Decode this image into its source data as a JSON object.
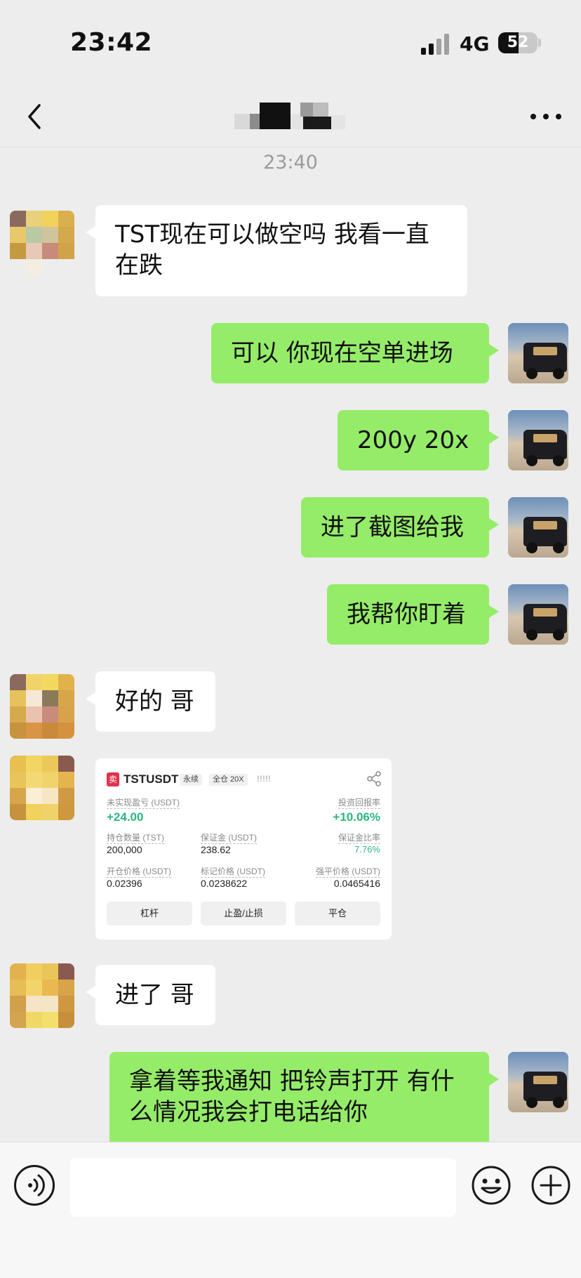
{
  "status_bar": {
    "time": "23:42",
    "network": "4G",
    "battery": "52",
    "icons": [
      "signal-icon",
      "battery-icon"
    ]
  },
  "nav": {
    "back_icon": "chevron-left-icon",
    "more_icon": "ellipsis-icon",
    "title_blurred": true
  },
  "chat": {
    "timestamp": "23:40",
    "messages": [
      {
        "side": "in",
        "lines": [
          "TST现在可以做空吗 我看一直",
          "在跌"
        ]
      },
      {
        "side": "out",
        "lines": [
          "可以 你现在空单进场"
        ]
      },
      {
        "side": "out",
        "lines": [
          "200y 20x"
        ]
      },
      {
        "side": "out",
        "lines": [
          "进了截图给我"
        ]
      },
      {
        "side": "out",
        "lines": [
          "我帮你盯着"
        ]
      },
      {
        "side": "in",
        "lines": [
          "好的 哥"
        ]
      },
      {
        "side": "in",
        "type": "image-card"
      },
      {
        "side": "in",
        "lines": [
          "进了 哥"
        ]
      },
      {
        "side": "out",
        "lines": [
          "拿着等我通知 把铃声打开 有什",
          "么情况我会打电话给你"
        ]
      }
    ]
  },
  "trade_card": {
    "sell_tag": "卖",
    "pair": "TSTUSDT",
    "tag_perpetual": "永续",
    "tag_margin": "全仓 20X",
    "leverage_marks": "!!!!!",
    "unrealized_pnl_label": "未实现盈亏 (USDT)",
    "unrealized_pnl_value": "+24.00",
    "roe_label": "投资回报率",
    "roe_value": "+10.06%",
    "position_qty_label": "持仓数量 (TST)",
    "position_qty_value": "200,000",
    "margin_label": "保证金 (USDT)",
    "margin_value": "238.62",
    "margin_ratio_label": "保证金比率",
    "margin_ratio_value": "7.76%",
    "entry_price_label": "开仓价格 (USDT)",
    "entry_price_value": "0.02396",
    "mark_price_label": "标记价格 (USDT)",
    "mark_price_value": "0.0238622",
    "liq_price_label": "强平价格 (USDT)",
    "liq_price_value": "0.0465416",
    "btn_leverage": "杠杆",
    "btn_tpsl": "止盈/止损",
    "btn_close": "平仓",
    "colors": {
      "sell": "#e0314b",
      "profit": "#2eb67d"
    }
  },
  "input_bar": {
    "placeholder": "",
    "icons": [
      "voice-icon",
      "emoji-icon",
      "plus-icon"
    ]
  },
  "colors": {
    "background": "#ededed",
    "bubble_out": "#95ec69",
    "bubble_in": "#ffffff",
    "timestamp": "#9b9b9b"
  }
}
